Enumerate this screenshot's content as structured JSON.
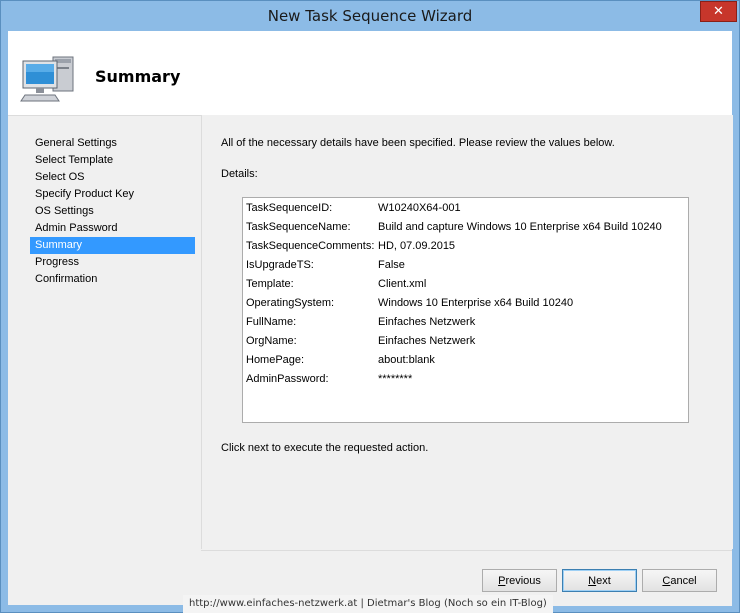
{
  "window": {
    "title": "New Task Sequence Wizard",
    "close_glyph": "✕"
  },
  "header": {
    "title": "Summary",
    "icon": "computer-icon"
  },
  "nav": {
    "items": [
      {
        "label": "General Settings",
        "selected": false
      },
      {
        "label": "Select Template",
        "selected": false
      },
      {
        "label": "Select OS",
        "selected": false
      },
      {
        "label": "Specify Product Key",
        "selected": false
      },
      {
        "label": "OS Settings",
        "selected": false
      },
      {
        "label": "Admin Password",
        "selected": false
      },
      {
        "label": "Summary",
        "selected": true
      },
      {
        "label": "Progress",
        "selected": false
      },
      {
        "label": "Confirmation",
        "selected": false
      }
    ]
  },
  "main": {
    "intro": "All of the necessary details have been specified.  Please review the values below.",
    "details_label": "Details:",
    "details": [
      {
        "key": "TaskSequenceID:",
        "value": "W10240X64-001"
      },
      {
        "key": "TaskSequenceName:",
        "value": "Build and capture Windows 10 Enterprise x64 Build 10240"
      },
      {
        "key": "TaskSequenceComments:",
        "value": "HD, 07.09.2015"
      },
      {
        "key": "IsUpgradeTS:",
        "value": "False"
      },
      {
        "key": "Template:",
        "value": "Client.xml"
      },
      {
        "key": "OperatingSystem:",
        "value": "Windows 10 Enterprise x64 Build 10240"
      },
      {
        "key": "FullName:",
        "value": "Einfaches Netzwerk"
      },
      {
        "key": "OrgName:",
        "value": "Einfaches Netzwerk"
      },
      {
        "key": "HomePage:",
        "value": "about:blank"
      },
      {
        "key": "AdminPassword:",
        "value": "********"
      }
    ],
    "next_text": "Click next to execute the requested action."
  },
  "buttons": {
    "previous": {
      "label": "Previous",
      "accel": "P",
      "rest": "revious"
    },
    "next": {
      "label": "Next",
      "accel": "N",
      "rest": "ext"
    },
    "cancel": {
      "label": "Cancel",
      "accel": "C",
      "rest": "ancel"
    }
  },
  "watermark": "http://www.einfaches-netzwerk.at | Dietmar's Blog (Noch so ein IT-Blog)"
}
